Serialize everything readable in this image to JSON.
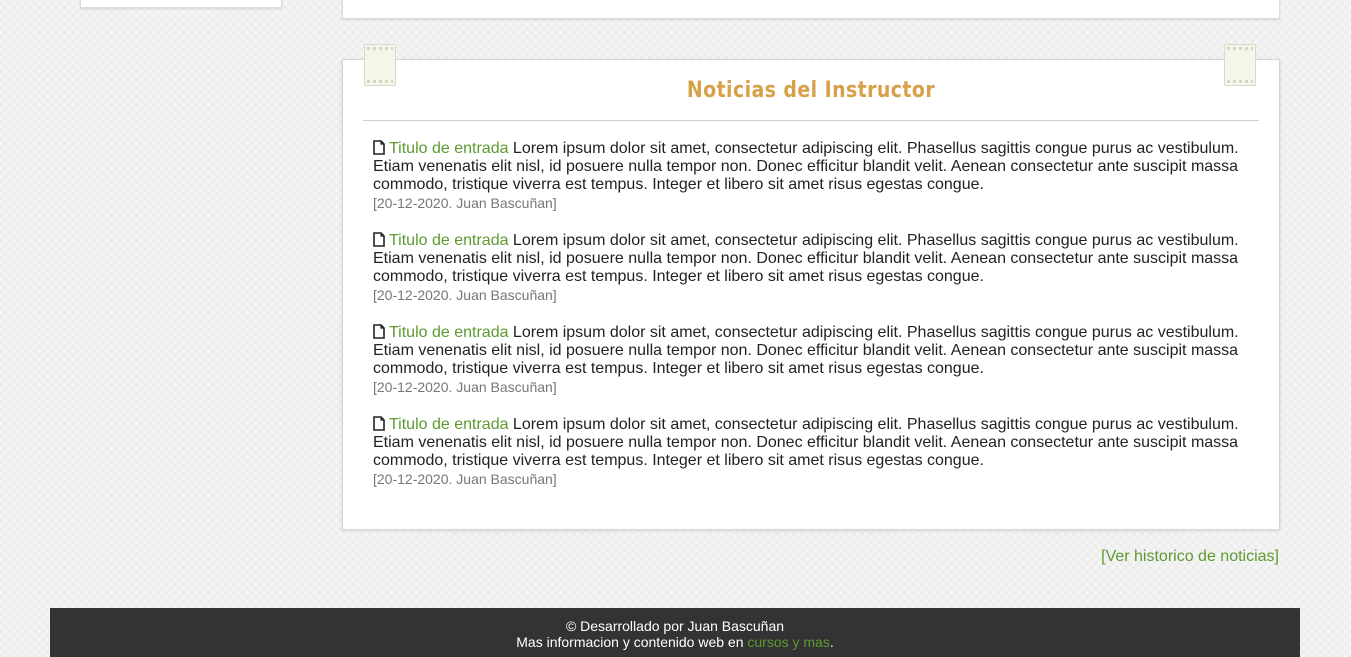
{
  "news": {
    "title": "Noticias del Instructor",
    "items": [
      {
        "link": "Titulo de entrada",
        "text": " Lorem ipsum dolor sit amet, consectetur adipiscing elit. Phasellus sagittis congue purus ac vestibulum. Etiam venenatis elit nisl, id posuere nulla tempor non. Donec efficitur blandit velit. Aenean consectetur ante suscipit massa commodo, tristique viverra est tempus. Integer et libero sit amet risus egestas congue.",
        "meta": "[20-12-2020. Juan Bascuñan]",
        "icon": "document-icon"
      },
      {
        "link": "Titulo de entrada",
        "text": " Lorem ipsum dolor sit amet, consectetur adipiscing elit. Phasellus sagittis congue purus ac vestibulum. Etiam venenatis elit nisl, id posuere nulla tempor non. Donec efficitur blandit velit. Aenean consectetur ante suscipit massa commodo, tristique viverra est tempus. Integer et libero sit amet risus egestas congue.",
        "meta": "[20-12-2020. Juan Bascuñan]",
        "icon": "document-icon"
      },
      {
        "link": "Titulo de entrada",
        "text": " Lorem ipsum dolor sit amet, consectetur adipiscing elit. Phasellus sagittis congue purus ac vestibulum. Etiam venenatis elit nisl, id posuere nulla tempor non. Donec efficitur blandit velit. Aenean consectetur ante suscipit massa commodo, tristique viverra est tempus. Integer et libero sit amet risus egestas congue.",
        "meta": "[20-12-2020. Juan Bascuñan]",
        "icon": "document-icon"
      },
      {
        "link": "Titulo de entrada",
        "text": " Lorem ipsum dolor sit amet, consectetur adipiscing elit. Phasellus sagittis congue purus ac vestibulum. Etiam venenatis elit nisl, id posuere nulla tempor non. Donec efficitur blandit velit. Aenean consectetur ante suscipit massa commodo, tristique viverra est tempus. Integer et libero sit amet risus egestas congue.",
        "meta": "[20-12-2020. Juan Bascuñan]",
        "icon": "document-icon"
      }
    ],
    "history_link": "[Ver historico de noticias]"
  },
  "footer": {
    "credit": "© Desarrollado por Juan Bascuñan",
    "more_prefix": "Mas informacion y contenido web en ",
    "more_link": "cursos y mas",
    "more_suffix": "."
  },
  "colors": {
    "accent_title": "#d7a14a",
    "link_green": "#5c9a2f",
    "footer_bg": "#333333"
  }
}
